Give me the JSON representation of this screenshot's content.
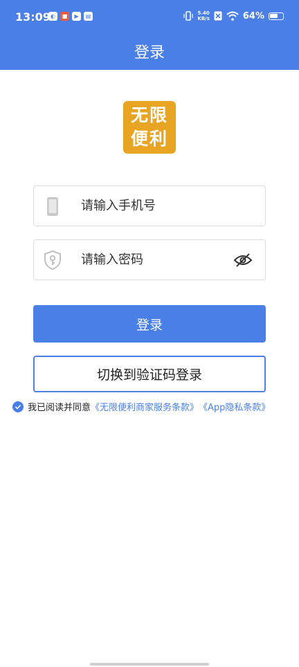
{
  "status_bar": {
    "time": "13:09",
    "network_speed_value": "5.40",
    "network_speed_unit": "KB/s",
    "battery": "64%"
  },
  "header": {
    "title": "登录",
    "bg_color": "#4a7fe8"
  },
  "logo": {
    "line1": "无限",
    "line2": "便利",
    "color": "#e8a423"
  },
  "phone_field": {
    "placeholder": "请输入手机号",
    "value": ""
  },
  "password_field": {
    "placeholder": "请输入密码",
    "value": ""
  },
  "login_button": {
    "label": "登录"
  },
  "switch_button": {
    "label": "切换到验证码登录"
  },
  "agreement": {
    "checked": true,
    "prefix": "我已阅读并同意",
    "link1": "《无限便利商家服务条款》",
    "link2": "《App隐私条款》"
  },
  "icons": [
    "phone-icon",
    "shield-key-icon",
    "eye-off-icon",
    "check-icon"
  ]
}
